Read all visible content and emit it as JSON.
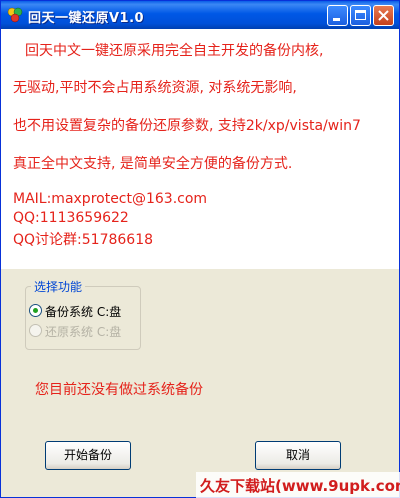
{
  "window": {
    "title": "回天一键还原V1.0",
    "minimize_icon": "minimize-icon",
    "maximize_icon": "maximize-icon",
    "close_icon": "close-icon"
  },
  "info": {
    "line1": "回天中文一键还原采用完全自主开发的备份内核,",
    "line2": "无驱动,平时不会占用系统资源, 对系统无影响,",
    "line3": "也不用设置复杂的备份还原参数, 支持2k/xp/vista/win7",
    "line4": "真正全中文支持, 是简单安全方便的备份方式.",
    "mail": "MAIL:maxprotect@163.com",
    "qq": "QQ:1113659622",
    "qq_group": "QQ讨论群:51786618"
  },
  "function_group": {
    "title": "选择功能",
    "options": [
      {
        "label": "备份系统 C:盘",
        "selected": true,
        "enabled": true
      },
      {
        "label": "还原系统 C:盘",
        "selected": false,
        "enabled": false
      }
    ]
  },
  "status_text": "您目前还没有做过系统备份",
  "buttons": {
    "start": "开始备份",
    "cancel": "取消"
  },
  "watermark": "久友下载站(www.9upk.com)",
  "colors": {
    "message_red": "#e5231b",
    "titlebar_blue": "#0058e6",
    "group_title_blue": "#0046d5"
  }
}
